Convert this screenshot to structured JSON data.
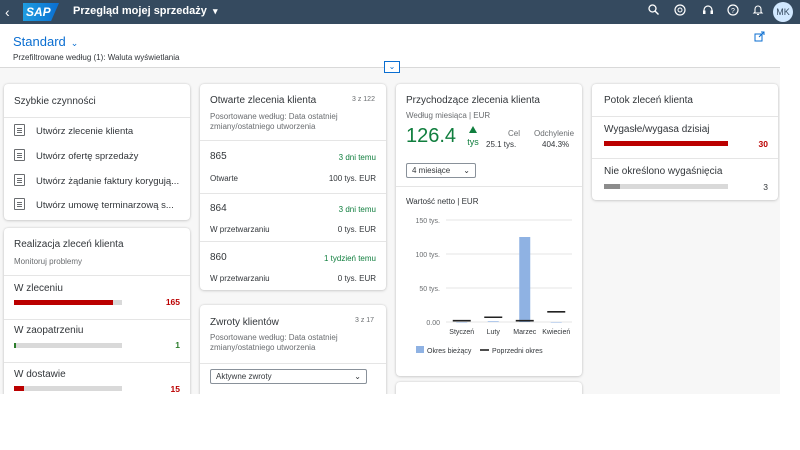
{
  "shell": {
    "back_icon": "arrow-left-icon",
    "logo": "SAP",
    "title": "Przegląd mojej sprzedaży",
    "title_chevron": "▾",
    "user_initials": "MK"
  },
  "header": {
    "variant": "Standard",
    "prefilter": "Przefiltrowane według (1): Waluta wyświetlania"
  },
  "quick_actions": {
    "title": "Szybkie czynności",
    "items": [
      "Utwórz zlecenie klienta",
      "Utwórz ofertę sprzedaży",
      "Utwórz żądanie faktury korygują...",
      "Utwórz umowę terminarzową s..."
    ]
  },
  "fulfillment": {
    "title": "Realizacja zleceń klienta",
    "subtitle": "Monitoruj problemy",
    "items": [
      {
        "label": "W zleceniu",
        "value": "165",
        "fill": 0.92,
        "color": "#bb0000"
      },
      {
        "label": "W zaopatrzeniu",
        "value": "1",
        "fill": 0.02,
        "color": "#2b7d2b"
      },
      {
        "label": "W dostawie",
        "value": "15",
        "fill": 0.09,
        "color": "#bb0000"
      }
    ]
  },
  "open_orders": {
    "title": "Otwarte zlecenia klienta",
    "count": "3 z 122",
    "subtitle": "Posortowane według: Data ostatniej zmiany/ostatniego utworzenia",
    "rows": [
      {
        "id": "865",
        "time": "3 dni temu",
        "status": "Otwarte",
        "amount": "100 tys. EUR"
      },
      {
        "id": "864",
        "time": "3 dni temu",
        "status": "W przetwarzaniu",
        "amount": "0 tys. EUR"
      },
      {
        "id": "860",
        "time": "1 tydzień temu",
        "status": "W przetwarzaniu",
        "amount": "0 tys. EUR"
      }
    ]
  },
  "returns": {
    "title": "Zwroty klientów",
    "count": "3 z 17",
    "subtitle": "Posortowane według: Data ostatniej zmiany/ostatniego utworzenia",
    "filter": "Aktywne zwroty"
  },
  "incoming": {
    "title": "Przychodzące zlecenia klienta",
    "subtitle": "Według miesiąca | EUR",
    "value": "126.4",
    "unit": "tys",
    "trend_icon": "triangle-up-icon",
    "target_label": "Cel",
    "target_value": "25.1 tys.",
    "deviation_label": "Odchylenie",
    "deviation_value": "404.3%",
    "period": "4 miesiące",
    "chart_title": "Wartość netto | EUR"
  },
  "flow": {
    "title": "Potok zleceń klienta",
    "items": [
      {
        "label": "Wygasłe/wygasa dzisiaj",
        "value": "30",
        "fill": 1.0,
        "color": "#bb0000"
      },
      {
        "label": "Nie określono wygaśnięcia",
        "value": "3",
        "fill": 0.13,
        "color": "#8c8c8c"
      }
    ]
  },
  "chart_data": {
    "type": "bar",
    "title": "Wartość netto | EUR",
    "categories": [
      "Styczeń",
      "Luty",
      "Marzec",
      "Kwiecień"
    ],
    "series": [
      {
        "name": "Okres bieżący",
        "values": [
          0,
          1,
          125,
          0
        ],
        "color": "#8fb2e3"
      },
      {
        "name": "Poprzedni okres",
        "values": [
          2,
          7,
          2,
          15
        ],
        "color": "#222222",
        "style": "line-marker"
      }
    ],
    "ylim": [
      0,
      150
    ],
    "yticks": [
      "0.00",
      "50 tys.",
      "100 tys.",
      "150 tys."
    ],
    "ytick_values": [
      0,
      50,
      100,
      150
    ],
    "legend": "bottom"
  }
}
